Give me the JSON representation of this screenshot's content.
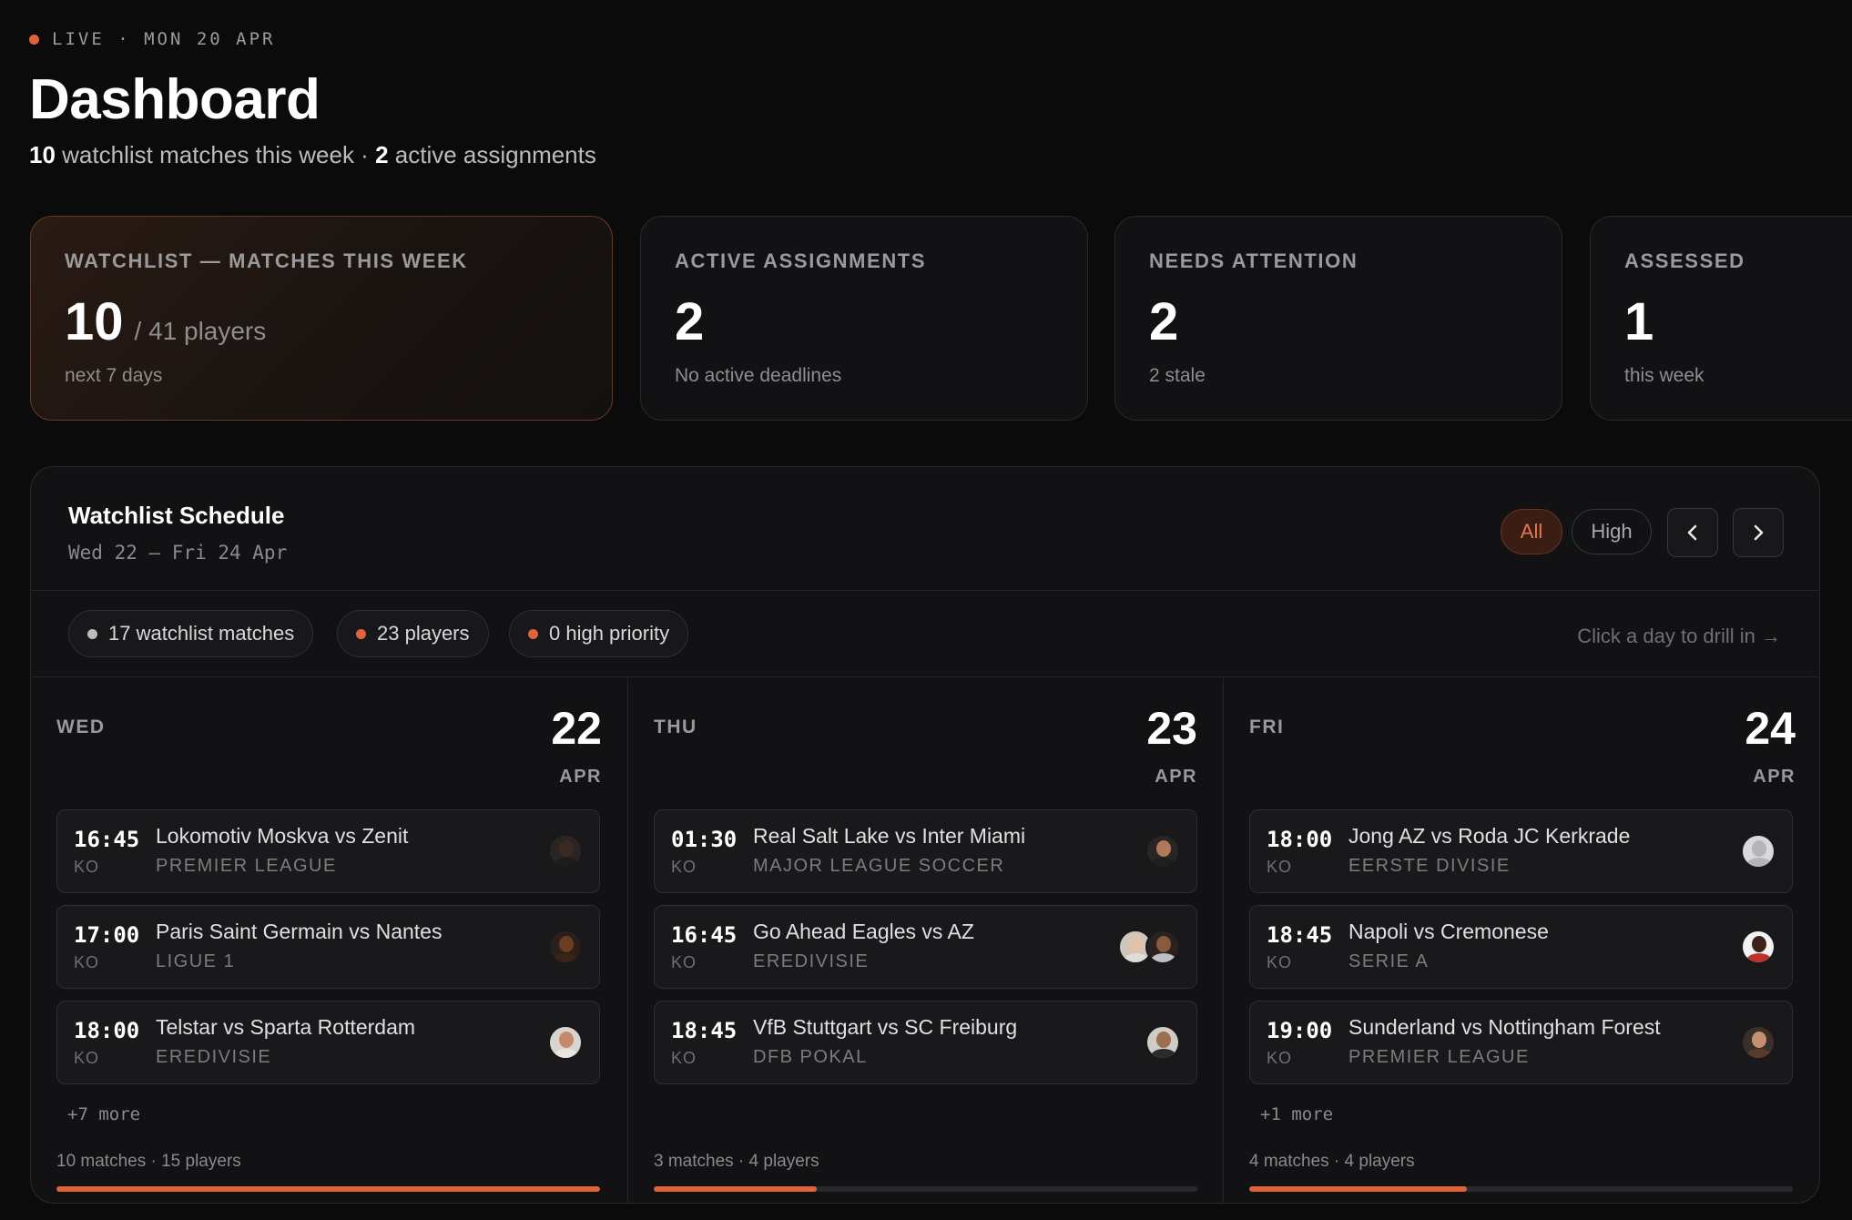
{
  "header": {
    "live_label": "LIVE · MON 20 APR",
    "title": "Dashboard",
    "summary_watchlist_count": "10",
    "summary_watchlist_text": "watchlist matches this week ·",
    "summary_assign_count": "2",
    "summary_assign_text": "active assignments"
  },
  "stats": [
    {
      "label": "WATCHLIST — MATCHES THIS WEEK",
      "value": "10",
      "sub": "/ 41 players",
      "note": "next 7 days"
    },
    {
      "label": "ACTIVE ASSIGNMENTS",
      "value": "2",
      "sub": "",
      "note": "No active deadlines"
    },
    {
      "label": "NEEDS ATTENTION",
      "value": "2",
      "sub": "",
      "note": "2 stale"
    },
    {
      "label": "ASSESSED",
      "value": "1",
      "sub": "",
      "note": "this week"
    }
  ],
  "schedule": {
    "title": "Watchlist Schedule",
    "range": "Wed 22 — Fri 24 Apr",
    "filters": [
      "All",
      "High"
    ],
    "active_filter": "All",
    "prev_icon": "chevron-left-icon",
    "next_icon": "chevron-right-icon",
    "chips": [
      {
        "label": "17 watchlist matches",
        "color": "#bdbdbd"
      },
      {
        "label": "23 players",
        "color": "#e0643a"
      },
      {
        "label": "0 high priority",
        "color": "#e0643a"
      }
    ],
    "hint": "Click a day to drill in →",
    "days": [
      {
        "dow": "WED",
        "day": "22",
        "month": "APR",
        "matches": [
          {
            "time": "16:45",
            "ko": "KO",
            "teams": "Lokomotiv Moskva vs Zenit",
            "competition": "PREMIER LEAGUE"
          },
          {
            "time": "17:00",
            "ko": "KO",
            "teams": "Paris Saint Germain vs Nantes",
            "competition": "LIGUE 1"
          },
          {
            "time": "18:00",
            "ko": "KO",
            "teams": "Telstar vs Sparta Rotterdam",
            "competition": "EREDIVISIE"
          }
        ],
        "more": "+7 more",
        "footer": "10 matches · 15 players",
        "load": 1.0
      },
      {
        "dow": "THU",
        "day": "23",
        "month": "APR",
        "matches": [
          {
            "time": "01:30",
            "ko": "KO",
            "teams": "Real Salt Lake vs Inter Miami",
            "competition": "MAJOR LEAGUE SOCCER"
          },
          {
            "time": "16:45",
            "ko": "KO",
            "teams": "Go Ahead Eagles vs AZ",
            "competition": "EREDIVISIE"
          },
          {
            "time": "18:45",
            "ko": "KO",
            "teams": "VfB Stuttgart vs SC Freiburg",
            "competition": "DFB POKAL"
          }
        ],
        "more": "",
        "footer": "3 matches · 4 players",
        "load": 0.3
      },
      {
        "dow": "FRI",
        "day": "24",
        "month": "APR",
        "matches": [
          {
            "time": "18:00",
            "ko": "KO",
            "teams": "Jong AZ vs Roda JC Kerkrade",
            "competition": "EERSTE DIVISIE"
          },
          {
            "time": "18:45",
            "ko": "KO",
            "teams": "Napoli vs Cremonese",
            "competition": "SERIE A"
          },
          {
            "time": "19:00",
            "ko": "KO",
            "teams": "Sunderland vs Nottingham Forest",
            "competition": "PREMIER LEAGUE"
          }
        ],
        "more": "+1 more",
        "footer": "4 matches · 4 players",
        "load": 0.4
      }
    ]
  },
  "colors": {
    "accent": "#e0643a",
    "background": "#0b0b0b",
    "card": "#121214"
  }
}
